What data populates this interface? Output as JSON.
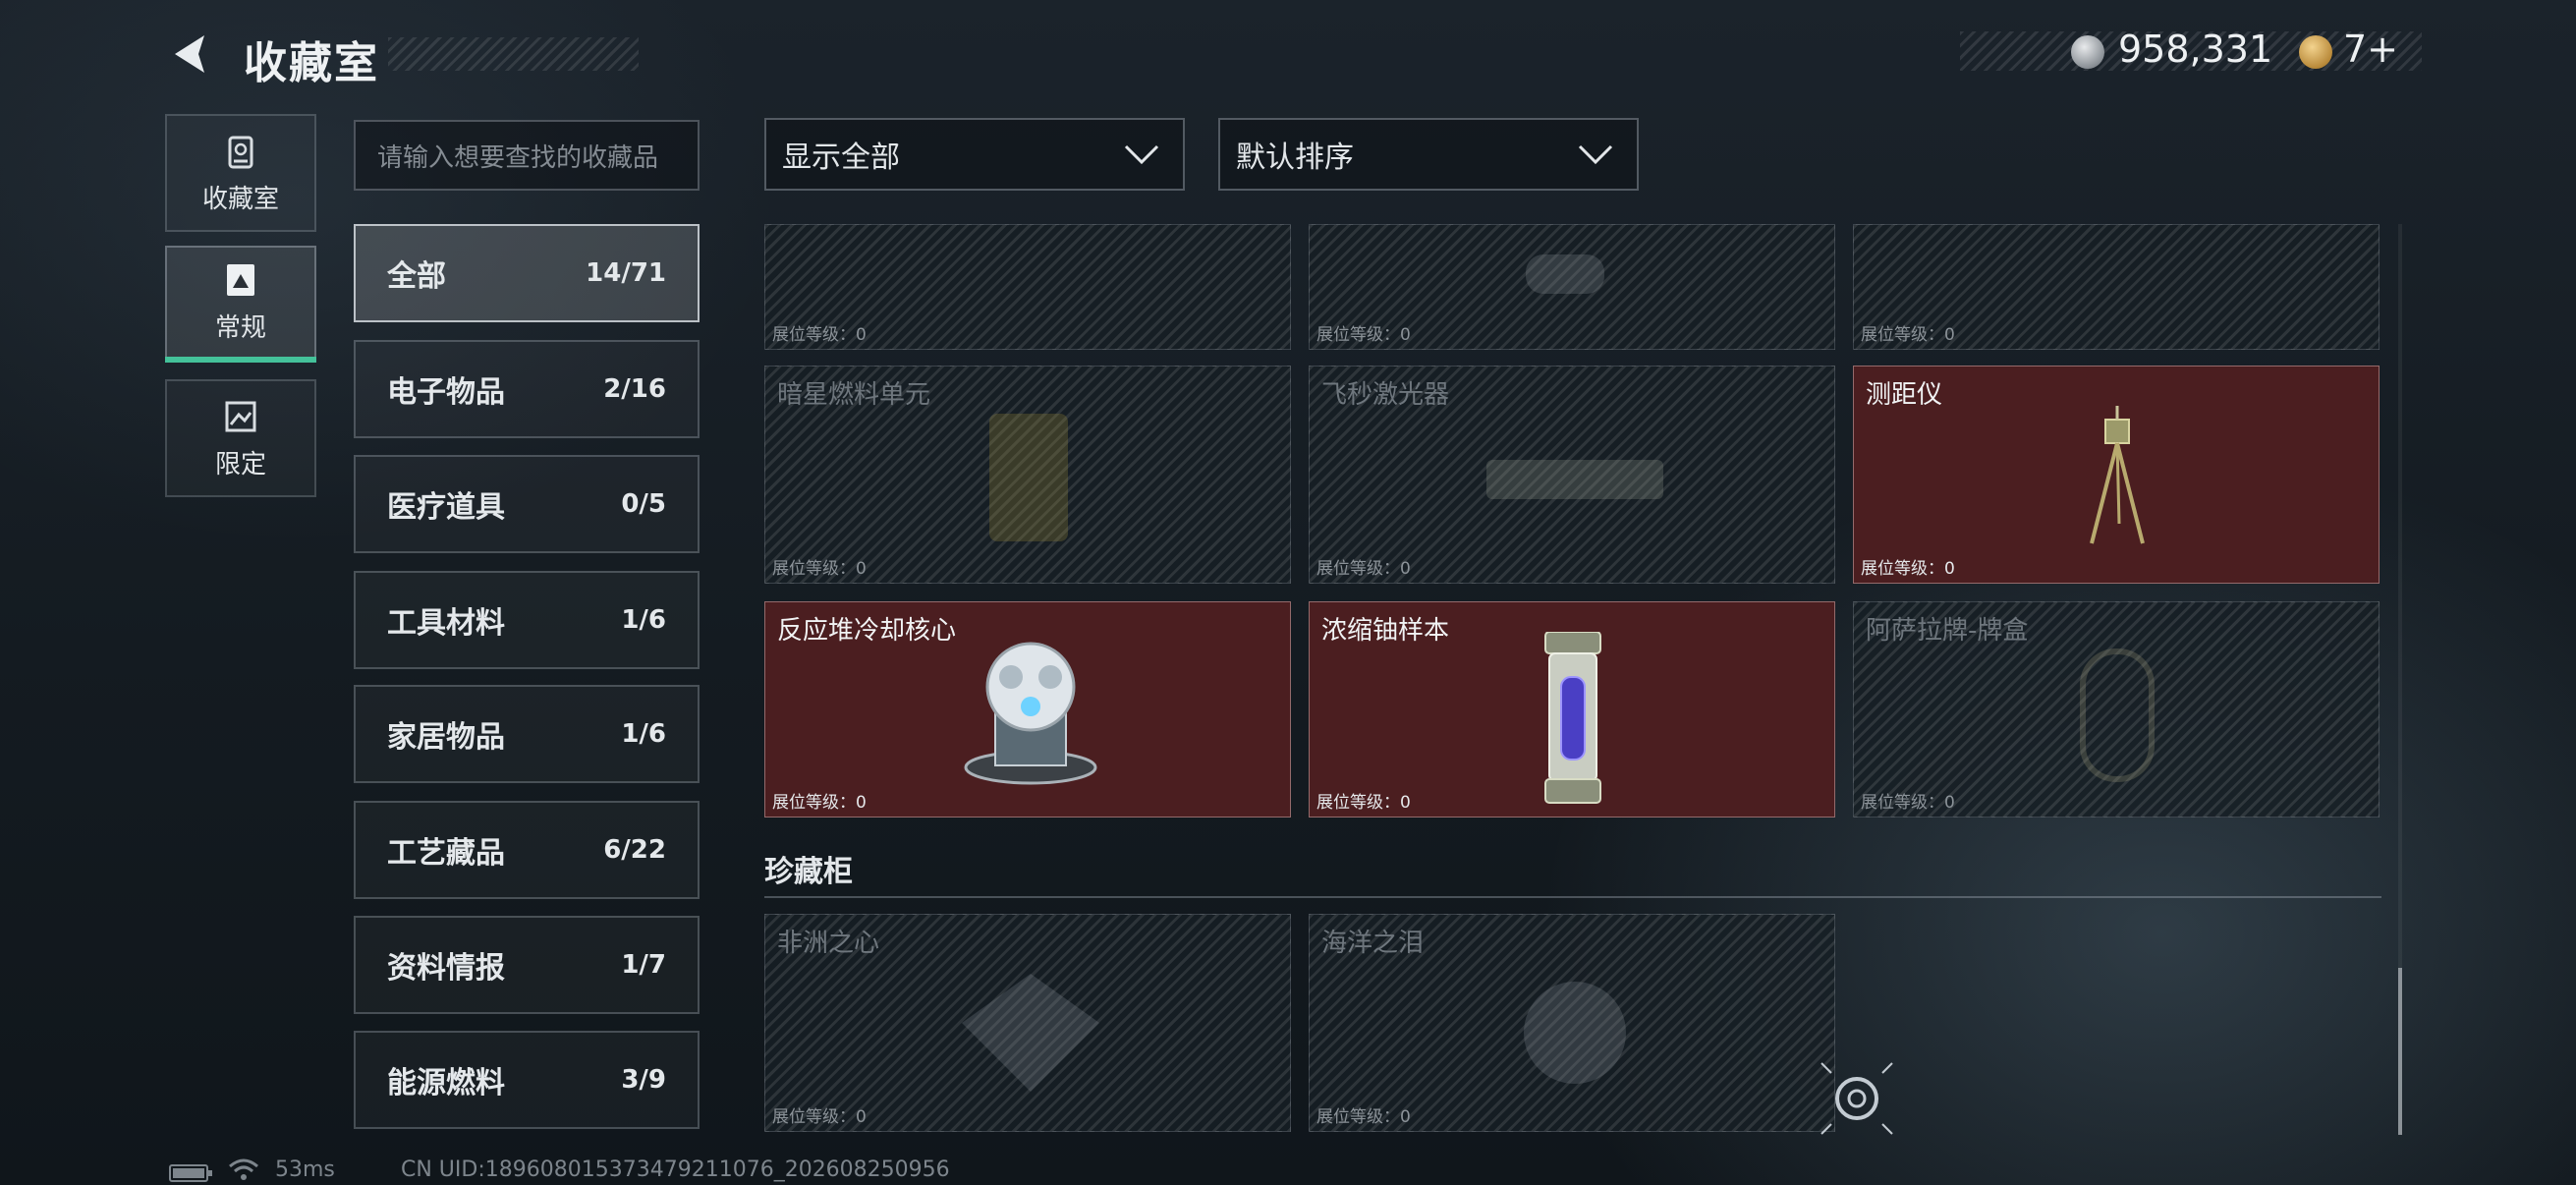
{
  "header": {
    "title": "收藏室",
    "coins": "958,331",
    "gold": "7+",
    "coin_icon": "silver-coin-icon",
    "gold_icon": "gold-coin-icon"
  },
  "left_nav": [
    {
      "label": "收藏室",
      "icon": "trash-bin-icon"
    },
    {
      "label": "常规",
      "icon": "picture-frame-icon"
    },
    {
      "label": "限定",
      "icon": "landscape-icon"
    }
  ],
  "search": {
    "placeholder": "请输入想要查找的收藏品"
  },
  "filters": {
    "show": "显示全部",
    "sort": "默认排序"
  },
  "categories": [
    {
      "label": "全部",
      "count": "14/71"
    },
    {
      "label": "电子物品",
      "count": "2/16"
    },
    {
      "label": "医疗道具",
      "count": "0/5"
    },
    {
      "label": "工具材料",
      "count": "1/6"
    },
    {
      "label": "家居物品",
      "count": "1/6"
    },
    {
      "label": "工艺藏品",
      "count": "6/22"
    },
    {
      "label": "资料情报",
      "count": "1/7"
    },
    {
      "label": "能源燃料",
      "count": "3/9"
    }
  ],
  "level_label": "展位等级：",
  "items_top": [
    {
      "name": "",
      "level": "0"
    },
    {
      "name": "",
      "level": "0"
    },
    {
      "name": "",
      "level": "0"
    }
  ],
  "items_mid": [
    {
      "name": "暗星燃料单元",
      "level": "0"
    },
    {
      "name": "飞秒激光器",
      "level": "0"
    },
    {
      "name": "测距仪",
      "level": "0"
    }
  ],
  "items_low": [
    {
      "name": "反应堆冷却核心",
      "level": "0"
    },
    {
      "name": "浓缩铀样本",
      "level": "0"
    },
    {
      "name": "阿萨拉牌-牌盒",
      "level": "0"
    }
  ],
  "section": {
    "title": "珍藏柜"
  },
  "treasure": [
    {
      "name": "非洲之心",
      "level": "0"
    },
    {
      "name": "海洋之泪",
      "level": "0"
    }
  ],
  "footer": {
    "ping": "53ms",
    "uid": "CN UID:1896080153734792110​76_202608250956"
  },
  "colors": {
    "accent": "#44c29a",
    "owned_card": "#4b1e20"
  }
}
